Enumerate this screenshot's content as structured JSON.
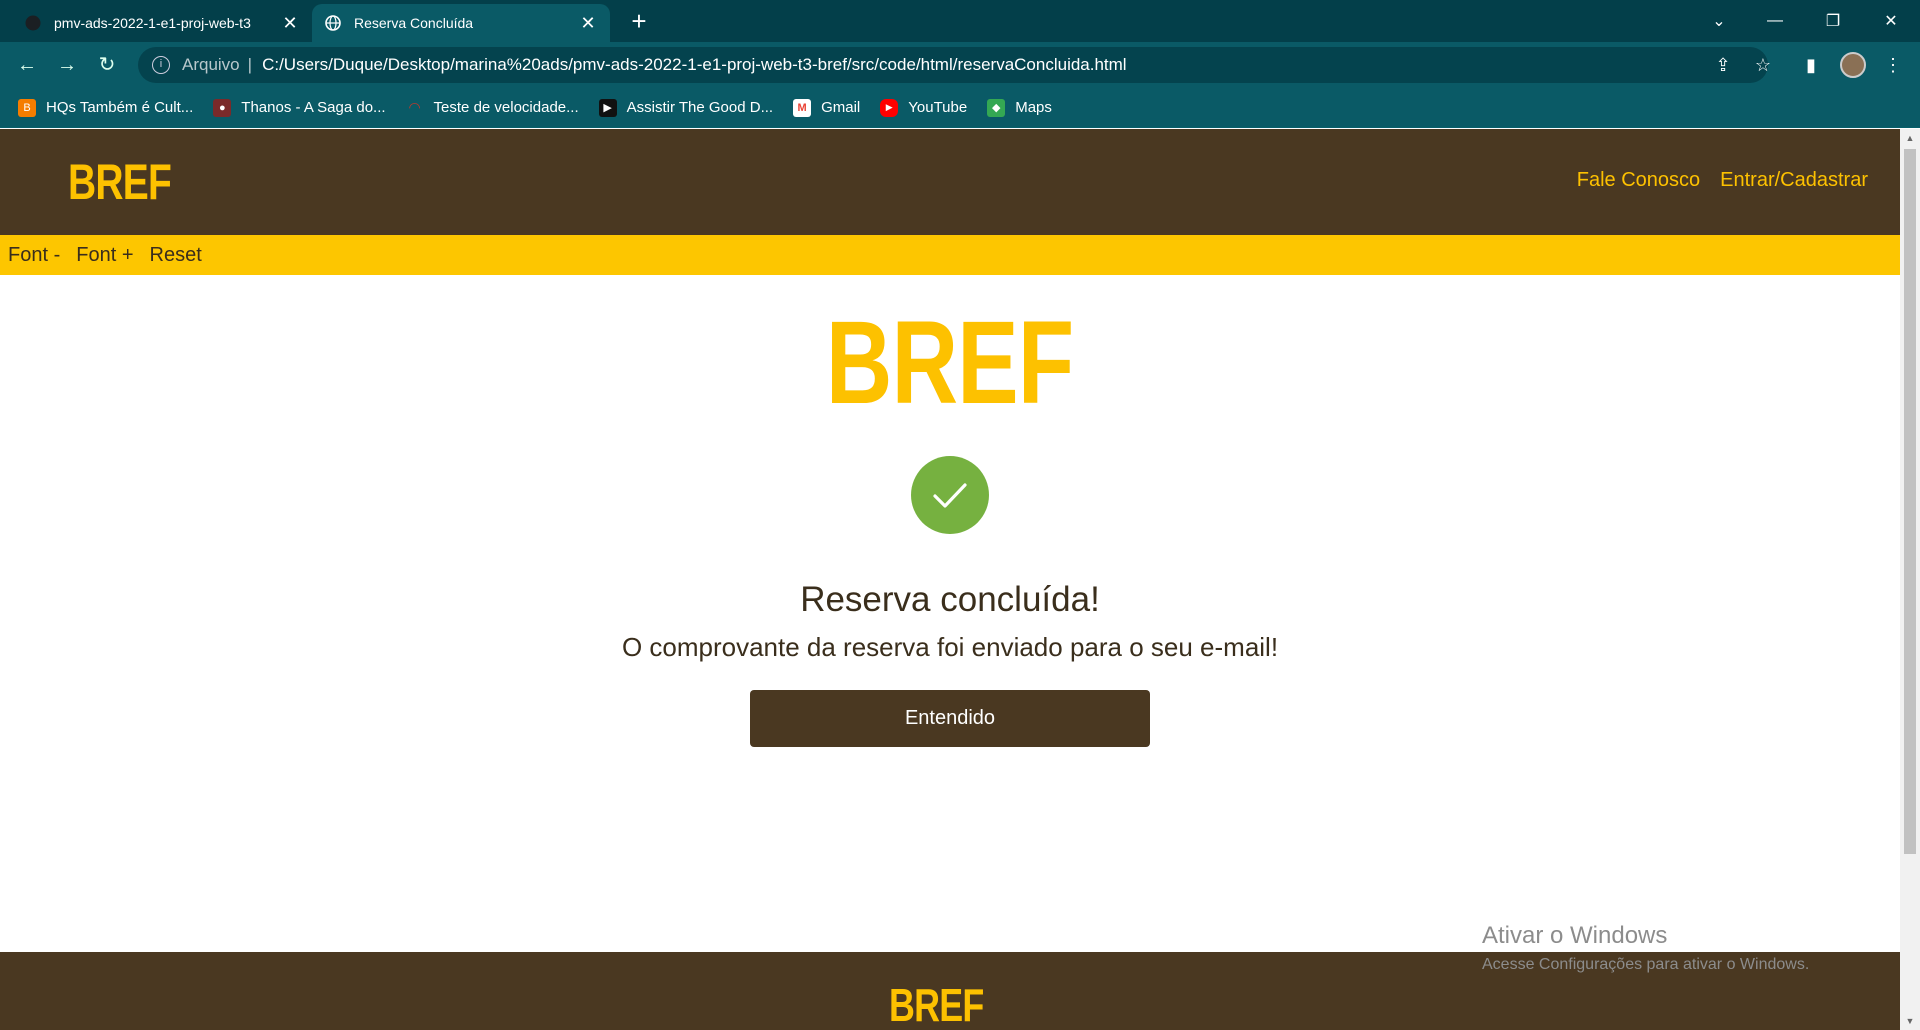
{
  "browser": {
    "tabs": [
      {
        "title": "pmv-ads-2022-1-e1-proj-web-t3",
        "icon": "github-icon",
        "active": false
      },
      {
        "title": "Reserva Concluída",
        "icon": "globe-icon",
        "active": true
      }
    ],
    "address": {
      "scheme_label": "Arquivo",
      "separator": "|",
      "url": "C:/Users/Duque/Desktop/marina%20ads/pmv-ads-2022-1-e1-proj-web-t3-bref/src/code/html/reservaConcluida.html"
    },
    "bookmarks": [
      {
        "label": "HQs Também é Cult...",
        "icon": "blogger-icon",
        "color": "#f57d00"
      },
      {
        "label": "Thanos - A Saga do...",
        "icon": "thanos-icon",
        "color": "#7a2a2a"
      },
      {
        "label": "Teste de velocidade...",
        "icon": "speedtest-icon",
        "color": "#c0392b"
      },
      {
        "label": "Assistir The Good D...",
        "icon": "play-icon",
        "color": "#111111"
      },
      {
        "label": "Gmail",
        "icon": "gmail-icon",
        "color": "#ea4335"
      },
      {
        "label": "YouTube",
        "icon": "youtube-icon",
        "color": "#ff0000"
      },
      {
        "label": "Maps",
        "icon": "maps-icon",
        "color": "#34a853"
      }
    ]
  },
  "site": {
    "logo": "BREF",
    "nav": {
      "contact": "Fale Conosco",
      "login": "Entrar/Cadastrar"
    },
    "accessibility": {
      "decrease": "Font -",
      "increase": "Font +",
      "reset": "Reset"
    },
    "confirmation": {
      "title": "Reserva concluída!",
      "message": "O comprovante da reserva foi enviado para o seu e-mail!",
      "button": "Entendido"
    },
    "footer_logo": "BREF"
  },
  "watermark": {
    "line1": "Ativar o Windows",
    "line2": "Acesse Configurações para ativar o Windows."
  },
  "colors": {
    "brand_brown": "#4a3821",
    "brand_yellow": "#fdc100",
    "success_green": "#76b140"
  }
}
